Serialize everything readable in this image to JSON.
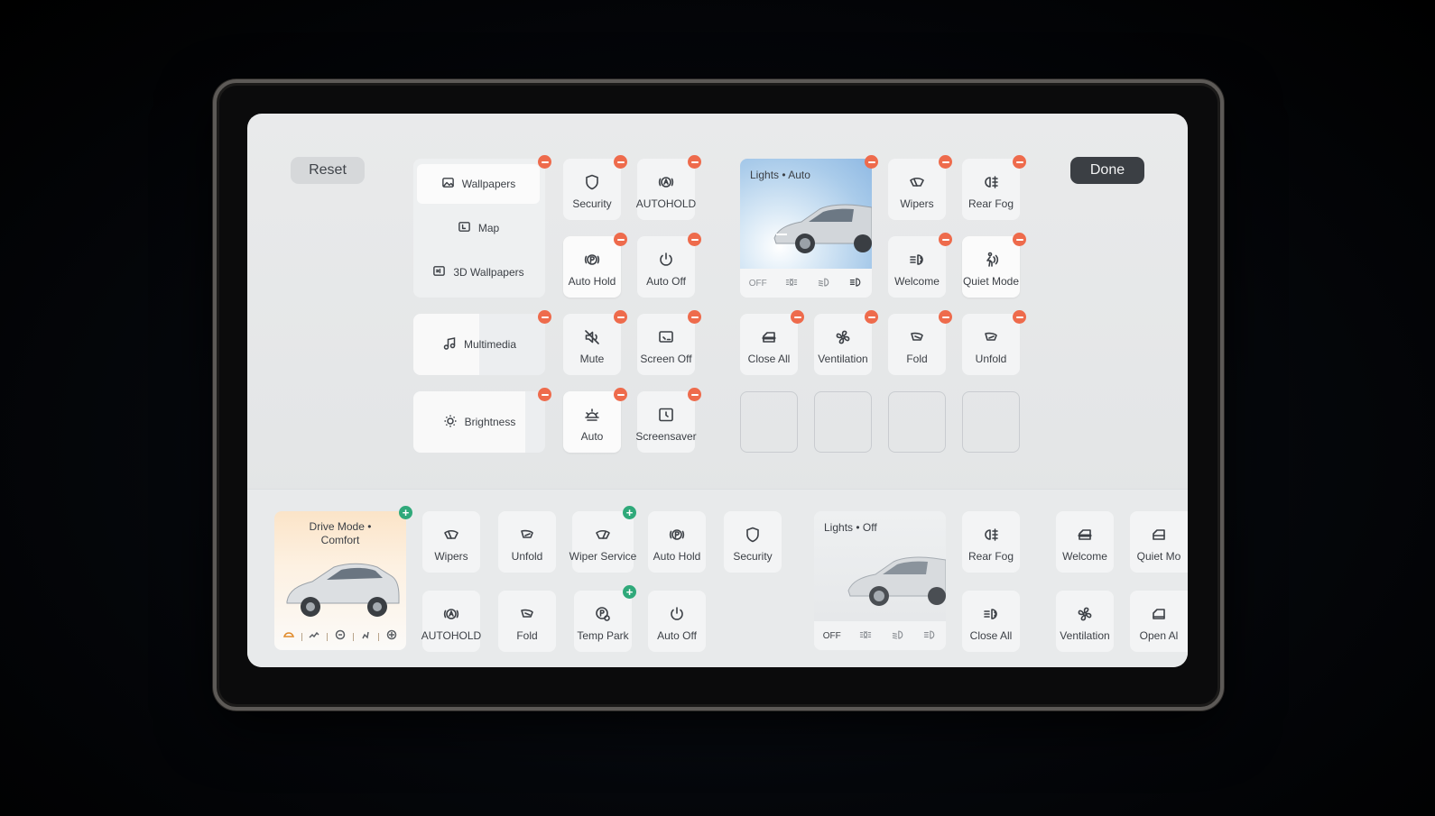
{
  "header": {
    "reset_label": "Reset",
    "done_label": "Done"
  },
  "wallpapers": {
    "items": [
      {
        "label": "Wallpapers",
        "icon": "image-icon"
      },
      {
        "label": "Map",
        "icon": "map-icon"
      },
      {
        "label": "3D Wallpapers",
        "icon": "3d-icon"
      }
    ]
  },
  "multimedia": {
    "label": "Multimedia"
  },
  "brightness": {
    "label": "Brightness"
  },
  "grid_tiles": {
    "security": "Security",
    "autohold": "AUTOHOLD",
    "auto_hold": "Auto Hold",
    "auto_off": "Auto Off",
    "mute": "Mute",
    "screen_off": "Screen Off",
    "auto": "Auto",
    "screensaver": "Screensaver",
    "wipers": "Wipers",
    "rear_fog": "Rear Fog",
    "welcome": "Welcome",
    "quiet_mode": "Quiet Mode",
    "close_all": "Close All",
    "ventilation": "Ventilation",
    "fold": "Fold",
    "unfold": "Unfold"
  },
  "lights_top": {
    "title": "Lights • Auto",
    "off_label": "OFF"
  },
  "tray": {
    "drive_mode_title_line1": "Drive Mode •",
    "drive_mode_title_line2": "Comfort",
    "wipers": "Wipers",
    "unfold": "Unfold",
    "wiper_service": "Wiper Service",
    "auto_hold": "Auto Hold",
    "security": "Security",
    "autohold": "AUTOHOLD",
    "fold": "Fold",
    "temp_park": "Temp Park",
    "auto_off": "Auto Off",
    "lights_title": "Lights • Off",
    "lights_off_label": "OFF",
    "rear_fog": "Rear Fog",
    "close_all": "Close All",
    "welcome": "Welcome",
    "ventilation": "Ventilation",
    "quiet_mode": "Quiet Mo",
    "open_all": "Open Al"
  },
  "colors": {
    "remove_badge": "#ee6b4c",
    "add_badge": "#2fa97a",
    "done_button": "#3b3f44"
  }
}
